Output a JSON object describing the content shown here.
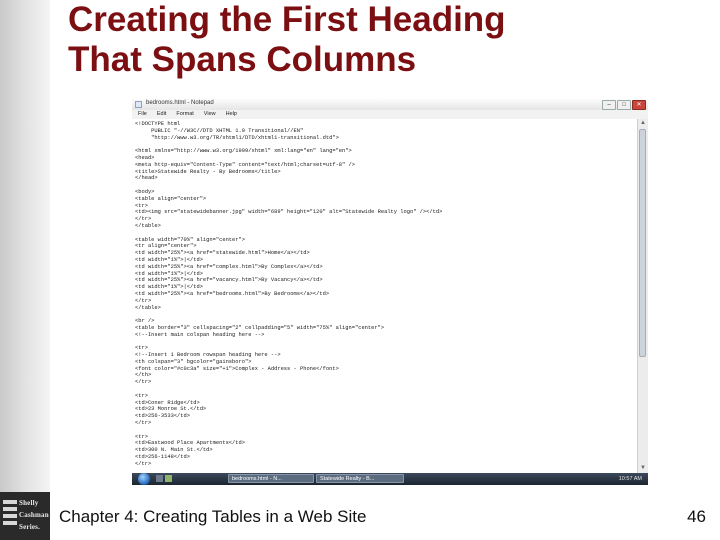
{
  "slide": {
    "title_line1": "Creating the First Heading",
    "title_line2": "That Spans Columns",
    "footer": "Chapter 4: Creating Tables in a Web Site",
    "page_number": "46",
    "title_color": "#7b0f12"
  },
  "logo": {
    "lines": [
      "Shelly",
      "Cashman",
      "Series."
    ]
  },
  "notepad": {
    "window_title": "bedrooms.html - Notepad",
    "menu": [
      "File",
      "Edit",
      "Format",
      "View",
      "Help"
    ],
    "window_buttons": [
      "–",
      "□",
      "✕"
    ],
    "code_lines": [
      "<!DOCTYPE html",
      "     PUBLIC \"-//W3C//DTD XHTML 1.0 Transitional//EN\"",
      "     \"http://www.w3.org/TR/xhtml1/DTD/xhtml1-transitional.dtd\">",
      "",
      "<html xmlns=\"http://www.w3.org/1999/xhtml\" xml:lang=\"en\" lang=\"en\">",
      "<head>",
      "<meta http-equiv=\"Content-Type\" content=\"text/html;charset=utf-8\" />",
      "<title>Statewide Realty - By Bedrooms</title>",
      "</head>",
      "",
      "<body>",
      "<table align=\"center\">",
      "<tr>",
      "<td><img src=\"statewidebanner.jpg\" width=\"689\" height=\"120\" alt=\"Statewide Realty logo\" /></td>",
      "</tr>",
      "</table>",
      "",
      "<table width=\"70%\" align=\"center\">",
      "<tr align=\"center\">",
      "<td width=\"25%\"><a href=\"statewide.html\">Home</a></td>",
      "<td width=\"1%\">|</td>",
      "<td width=\"25%\"><a href=\"complex.html\">By Complex</a></td>",
      "<td width=\"1%\">|</td>",
      "<td width=\"25%\"><a href=\"vacancy.html\">By Vacancy</a></td>",
      "<td width=\"1%\">|</td>",
      "<td width=\"25%\"><a href=\"bedrooms.html\">By Bedrooms</a></td>",
      "</tr>",
      "</table>",
      "",
      "<br />",
      "<table border=\"3\" cellspacing=\"2\" cellpadding=\"5\" width=\"75%\" align=\"center\">",
      "<!--Insert main colspan heading here -->",
      "",
      "<tr>",
      "<!--Insert 1 Bedroom rowspan heading here -->",
      "<th colspan=\"3\" bgcolor=\"gainsboro\">",
      "<font color=\"#c0c3a\" size=\"+1\">Complex - Address - Phone</font>",
      "</th>",
      "</tr>",
      "",
      "<tr>",
      "<td>Coner Ridge</td>",
      "<td>23 Monroe St.</td>",
      "<td>256-3533</td>",
      "</tr>",
      "",
      "<tr>",
      "<td>Eastwood Place Apartments</td>",
      "<td>300 N. Main St.</td>",
      "<td>256-1148</td>",
      "</tr>",
      "",
      "<tr>",
      "<!--Insert 2 Bedrooms rowspan heading here -->"
    ],
    "taskbar": {
      "tasks": [
        "bedrooms.html - N...",
        "Statewide Realty - B..."
      ],
      "clock": "10:57 AM"
    }
  }
}
